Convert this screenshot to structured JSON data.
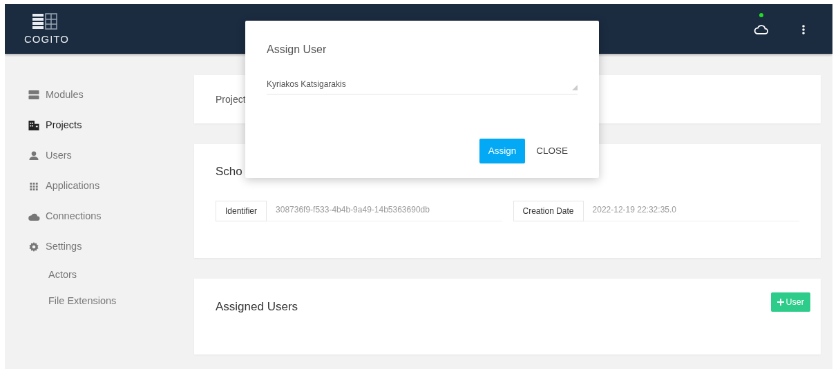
{
  "header": {
    "logo_text": "COGITO",
    "connection": {
      "online": true
    }
  },
  "sidebar": {
    "items": [
      {
        "label": "Modules",
        "selected": false
      },
      {
        "label": "Projects",
        "selected": true
      },
      {
        "label": "Users",
        "selected": false
      },
      {
        "label": "Applications",
        "selected": false
      },
      {
        "label": "Connections",
        "selected": false
      },
      {
        "label": "Settings",
        "selected": false,
        "children": [
          {
            "label": "Actors",
            "selected": false
          },
          {
            "label": "File Extensions",
            "selected": false
          }
        ]
      }
    ]
  },
  "project_card": {
    "title": "Project"
  },
  "details_card": {
    "title": "Scho",
    "fields": [
      {
        "label": "Identifier",
        "value": "308736f9-f533-4b4b-9a49-14b5363690db"
      },
      {
        "label": "Creation Date",
        "value": "2022-12-19 22:32:35.0"
      }
    ]
  },
  "users_card": {
    "title": "Assigned Users",
    "add_button": "User"
  },
  "modal": {
    "title": "Assign User",
    "select": {
      "value": "Kyriakos Katsigarakis"
    },
    "buttons": [
      {
        "label": "Assign",
        "kind": "primary"
      },
      {
        "label": "CLOSE",
        "kind": "text"
      }
    ]
  }
}
